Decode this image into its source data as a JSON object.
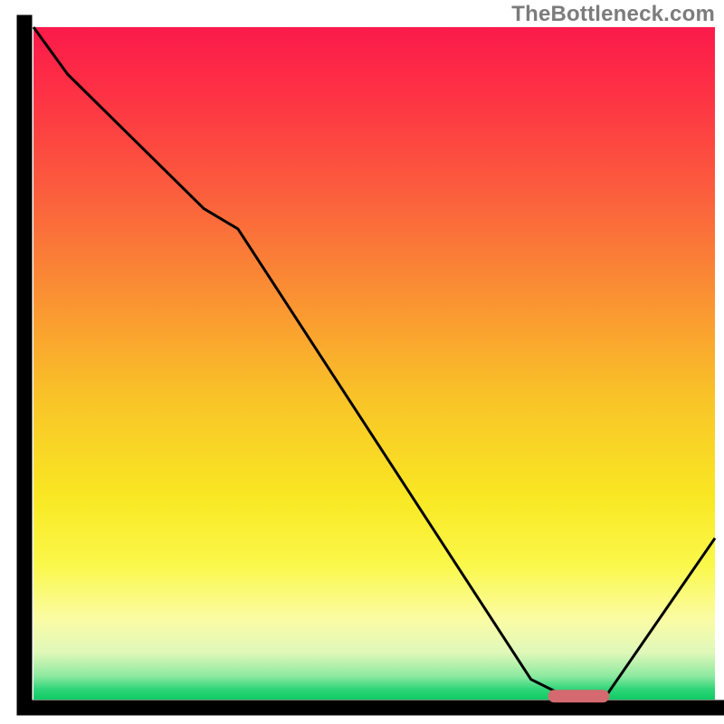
{
  "watermark": "TheBottleneck.com",
  "chart_data": {
    "type": "line",
    "title": "",
    "xlabel": "",
    "ylabel": "",
    "xlim": [
      0,
      100
    ],
    "ylim": [
      0,
      100
    ],
    "x": [
      0,
      5,
      25,
      30,
      73,
      78,
      84,
      100
    ],
    "y": [
      100,
      93,
      73,
      70,
      3,
      0.5,
      0.5,
      24
    ],
    "marker": {
      "x_center": 80,
      "y": 0.5,
      "width_pct": 9,
      "color": "#d46a6f"
    },
    "gradient_stops": [
      {
        "offset": 0.0,
        "color": "#fc1a4b"
      },
      {
        "offset": 0.1,
        "color": "#fd3244"
      },
      {
        "offset": 0.25,
        "color": "#fb5f3d"
      },
      {
        "offset": 0.4,
        "color": "#fa9133"
      },
      {
        "offset": 0.55,
        "color": "#f9c328"
      },
      {
        "offset": 0.7,
        "color": "#f9e823"
      },
      {
        "offset": 0.8,
        "color": "#faf84a"
      },
      {
        "offset": 0.88,
        "color": "#fbfca4"
      },
      {
        "offset": 0.93,
        "color": "#e0f8ba"
      },
      {
        "offset": 0.965,
        "color": "#8de9a0"
      },
      {
        "offset": 0.985,
        "color": "#2ed578"
      },
      {
        "offset": 1.0,
        "color": "#0fcb63"
      }
    ],
    "line_color": "#000000",
    "axis_color": "#000000"
  }
}
